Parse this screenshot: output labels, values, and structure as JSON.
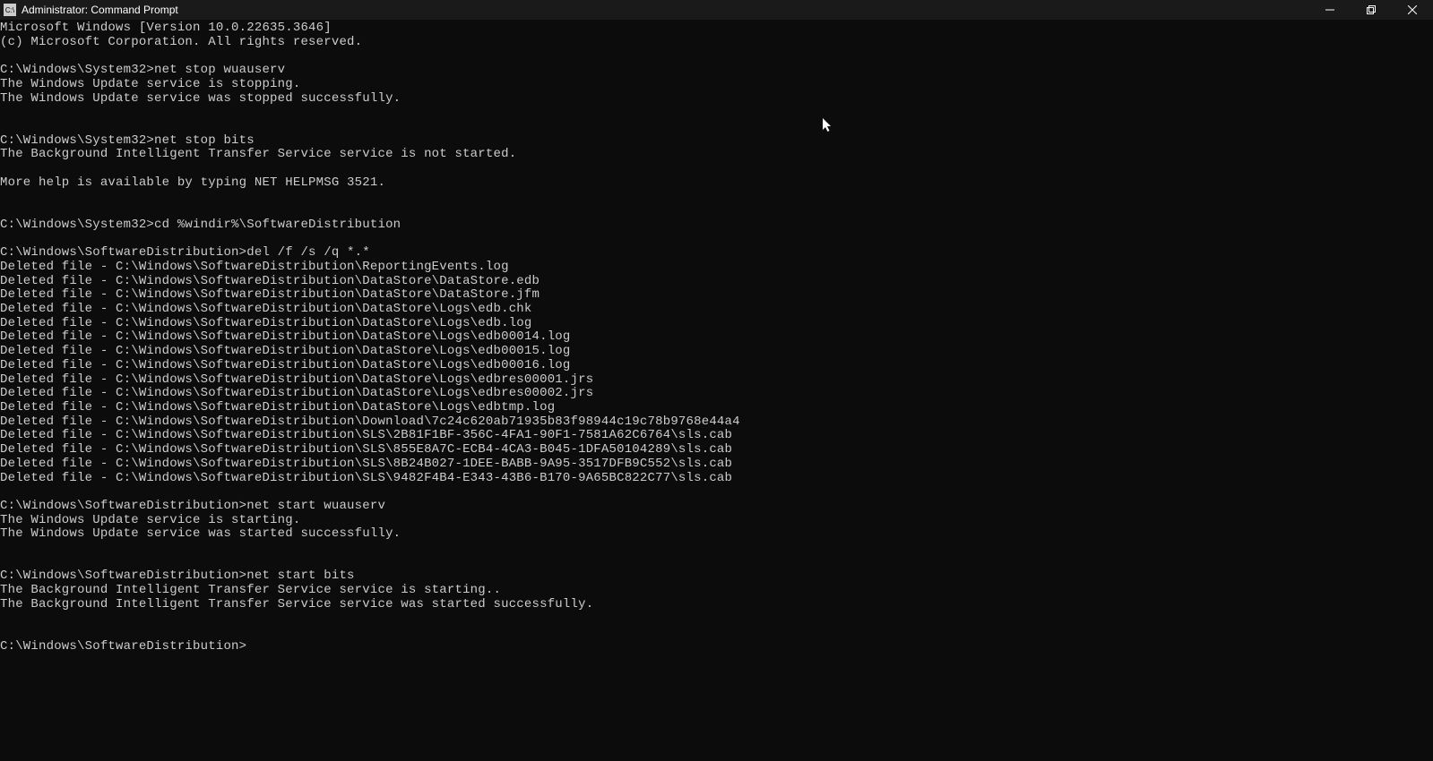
{
  "window": {
    "title": "Administrator: Command Prompt"
  },
  "terminal": {
    "lines": [
      "Microsoft Windows [Version 10.0.22635.3646]",
      "(c) Microsoft Corporation. All rights reserved.",
      "",
      "C:\\Windows\\System32>net stop wuauserv",
      "The Windows Update service is stopping.",
      "The Windows Update service was stopped successfully.",
      "",
      "",
      "C:\\Windows\\System32>net stop bits",
      "The Background Intelligent Transfer Service service is not started.",
      "",
      "More help is available by typing NET HELPMSG 3521.",
      "",
      "",
      "C:\\Windows\\System32>cd %windir%\\SoftwareDistribution",
      "",
      "C:\\Windows\\SoftwareDistribution>del /f /s /q *.*",
      "Deleted file - C:\\Windows\\SoftwareDistribution\\ReportingEvents.log",
      "Deleted file - C:\\Windows\\SoftwareDistribution\\DataStore\\DataStore.edb",
      "Deleted file - C:\\Windows\\SoftwareDistribution\\DataStore\\DataStore.jfm",
      "Deleted file - C:\\Windows\\SoftwareDistribution\\DataStore\\Logs\\edb.chk",
      "Deleted file - C:\\Windows\\SoftwareDistribution\\DataStore\\Logs\\edb.log",
      "Deleted file - C:\\Windows\\SoftwareDistribution\\DataStore\\Logs\\edb00014.log",
      "Deleted file - C:\\Windows\\SoftwareDistribution\\DataStore\\Logs\\edb00015.log",
      "Deleted file - C:\\Windows\\SoftwareDistribution\\DataStore\\Logs\\edb00016.log",
      "Deleted file - C:\\Windows\\SoftwareDistribution\\DataStore\\Logs\\edbres00001.jrs",
      "Deleted file - C:\\Windows\\SoftwareDistribution\\DataStore\\Logs\\edbres00002.jrs",
      "Deleted file - C:\\Windows\\SoftwareDistribution\\DataStore\\Logs\\edbtmp.log",
      "Deleted file - C:\\Windows\\SoftwareDistribution\\Download\\7c24c620ab71935b83f98944c19c78b9768e44a4",
      "Deleted file - C:\\Windows\\SoftwareDistribution\\SLS\\2B81F1BF-356C-4FA1-90F1-7581A62C6764\\sls.cab",
      "Deleted file - C:\\Windows\\SoftwareDistribution\\SLS\\855E8A7C-ECB4-4CA3-B045-1DFA50104289\\sls.cab",
      "Deleted file - C:\\Windows\\SoftwareDistribution\\SLS\\8B24B027-1DEE-BABB-9A95-3517DFB9C552\\sls.cab",
      "Deleted file - C:\\Windows\\SoftwareDistribution\\SLS\\9482F4B4-E343-43B6-B170-9A65BC822C77\\sls.cab",
      "",
      "C:\\Windows\\SoftwareDistribution>net start wuauserv",
      "The Windows Update service is starting.",
      "The Windows Update service was started successfully.",
      "",
      "",
      "C:\\Windows\\SoftwareDistribution>net start bits",
      "The Background Intelligent Transfer Service service is starting..",
      "The Background Intelligent Transfer Service service was started successfully.",
      "",
      "",
      "C:\\Windows\\SoftwareDistribution>"
    ]
  }
}
